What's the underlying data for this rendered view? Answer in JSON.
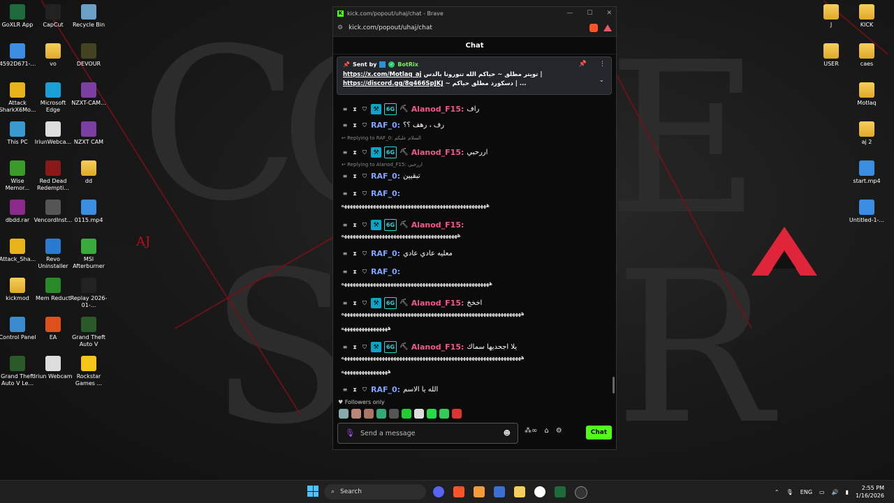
{
  "desktop": {
    "left_icons": [
      {
        "label": "GoXLR App",
        "icon": "goxlr-icon"
      },
      {
        "label": "CapCut",
        "icon": "capcut-icon"
      },
      {
        "label": "Recycle Bin",
        "icon": "recycle-bin-icon"
      },
      {
        "label": "4592D671-...",
        "icon": "file-icon"
      },
      {
        "label": "vo",
        "icon": "folder-icon"
      },
      {
        "label": "DEVOUR",
        "icon": "devour-icon"
      },
      {
        "label": "Attack SharkX6Mo...",
        "icon": "attack-shark-icon"
      },
      {
        "label": "Microsoft Edge",
        "icon": "edge-icon"
      },
      {
        "label": "NZXT-CAM...",
        "icon": "nzxt-icon"
      },
      {
        "label": "This PC",
        "icon": "pc-icon"
      },
      {
        "label": "IriunWebca...",
        "icon": "iriun-icon"
      },
      {
        "label": "NZXT CAM",
        "icon": "nzxt-icon"
      },
      {
        "label": "Wise Memor...",
        "icon": "wise-icon"
      },
      {
        "label": "Red Dead Redempti...",
        "icon": "rdr-icon"
      },
      {
        "label": "dd",
        "icon": "folder-icon"
      },
      {
        "label": "dbdd.rar",
        "icon": "rar-icon"
      },
      {
        "label": "VencordInst...",
        "icon": "vencord-icon"
      },
      {
        "label": "0115.mp4",
        "icon": "video-file-icon"
      },
      {
        "label": "Attack_Sha...",
        "icon": "attack-shark-icon"
      },
      {
        "label": "Revo Uninstaller",
        "icon": "revo-icon"
      },
      {
        "label": "MSI Afterburner",
        "icon": "msi-icon"
      },
      {
        "label": "kickmod",
        "icon": "folder-icon"
      },
      {
        "label": "Mem Reduct",
        "icon": "memreduct-icon"
      },
      {
        "label": "Replay 2026-01-...",
        "icon": "replay-icon"
      },
      {
        "label": "Control Panel",
        "icon": "control-panel-icon"
      },
      {
        "label": "EA",
        "icon": "ea-icon"
      },
      {
        "label": "Grand Theft Auto V",
        "icon": "gta-icon"
      },
      {
        "label": "Grand Theft Auto V Le...",
        "icon": "gta-icon"
      },
      {
        "label": "Iriun Webcam",
        "icon": "iriun-icon"
      },
      {
        "label": "Rockstar Games ...",
        "icon": "rockstar-icon"
      }
    ],
    "right_icons": [
      {
        "label": "J",
        "icon": "folder-icon"
      },
      {
        "label": "KICK",
        "icon": "folder-icon"
      },
      {
        "label": "USER",
        "icon": "folder-icon"
      },
      {
        "label": "caes",
        "icon": "folder-icon"
      },
      {
        "label": "Motlaq",
        "icon": "folder-icon"
      },
      {
        "label": "aj 2",
        "icon": "folder-icon"
      },
      {
        "label": "start.mp4",
        "icon": "video-file-icon"
      },
      {
        "label": "Untitled-1-...",
        "icon": "video-file-icon"
      }
    ],
    "wallpaper_logo": "AJ"
  },
  "browser": {
    "title": "kick.com/popout/uhaj/chat - Brave",
    "url": "kick.com/popout/uhaj/chat",
    "accent": "#53fc18"
  },
  "chat": {
    "header": "Chat",
    "pinned": {
      "sent_by": "Sent by",
      "bot_name": "BotRix",
      "line1_link": "https://x.com/Motlaq_aj",
      "line1_text": "تويتر مطلق ~ حياكم الله تنورونا بالدس |",
      "line2_link": "https://discord.gg/8q466SpJKJ",
      "line2_text": "~ دسكورد مطلق حياكم | ..."
    },
    "messages": [
      {
        "user": "Alanod_F15",
        "text": "راف"
      },
      {
        "user": "RAF_0",
        "text": "رف ، رهف ؟؟"
      },
      {
        "reply": "Replying to RAF_0: السلام عليكم",
        "user": "Alanod_F15",
        "text": "اررحبي"
      },
      {
        "reply": "Replying to Alanod_F15: اررحبي",
        "user": "RAF_0",
        "text": "تبقيين"
      },
      {
        "user": "RAF_0",
        "text": "",
        "wrap": [
          "ههههههههههههههههههههههههههههههههههههههههههههههههههه"
        ]
      },
      {
        "user": "Alanod_F15",
        "text": "",
        "wrap": [
          "ههههههههههههههههههههههههههههههههههههههههه"
        ]
      },
      {
        "user": "RAF_0",
        "text": "معليه عادي عادي"
      },
      {
        "user": "RAF_0",
        "text": "",
        "wrap": [
          "هههههههههههههههههههههههههههههههههههههههههههههههههههه"
        ]
      },
      {
        "user": "Alanod_F15",
        "text": "اخخخ",
        "wrap": [
          "ههههههههههههههههههههههههههههههههههههههههههههههههههههههههههههههه",
          "ههههههههههههههههه"
        ]
      },
      {
        "user": "Alanod_F15",
        "text": "يلا اجحديها سماك",
        "wrap": [
          "ههههههههههههههههههههههههههههههههههههههههههههههههههههههههههههههه",
          "ههههههههههههههههه"
        ]
      },
      {
        "user": "RAF_0",
        "text": "الله يا الاسم"
      }
    ],
    "followers_only": "Followers only",
    "input_placeholder": "Send a message",
    "send_label": "Chat"
  },
  "taskbar": {
    "search_label": "Search",
    "language": "ENG",
    "time": "2:55 PM",
    "date": "1/16/2026"
  }
}
